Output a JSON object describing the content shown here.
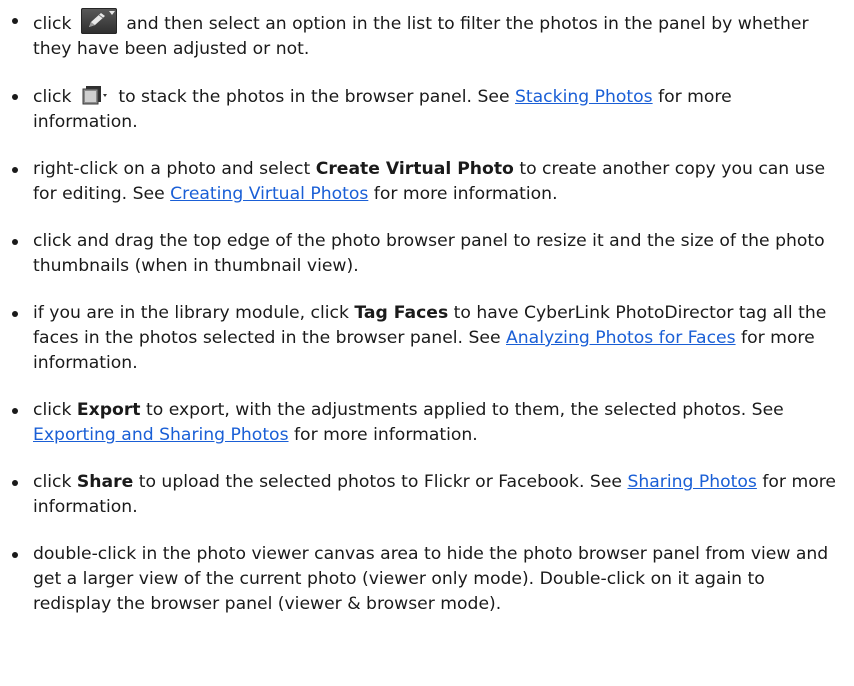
{
  "items": [
    {
      "a": "click",
      "icon": "edit-pencil-dropdown-icon",
      "b": "and then select an option in the list to filter the photos in the panel by whether they have been adjusted or not."
    },
    {
      "a": "click",
      "icon": "stack-dropdown-icon",
      "b": "to stack the photos in the browser panel. See",
      "link": "Stacking Photos",
      "c": "for more information."
    },
    {
      "a": "right-click on a photo and select",
      "bold": "Create Virtual Photo",
      "b": "to create another copy you can use for editing. See",
      "link": "Creating Virtual Photos",
      "c": "for more information."
    },
    {
      "a": "click and drag the top edge of the photo browser panel to resize it and the size of the photo thumbnails (when in thumbnail view)."
    },
    {
      "a": "if you are in the library module, click",
      "bold": "Tag Faces",
      "b": "to have CyberLink PhotoDirector tag all the faces in the photos selected in the browser panel. See",
      "link": "Analyzing Photos for Faces",
      "c": "for more information."
    },
    {
      "a": "click",
      "bold": "Export",
      "b": "to export, with the adjustments applied to them, the selected photos. See",
      "link": "Exporting and Sharing Photos",
      "c": "for more information."
    },
    {
      "a": "click",
      "bold": "Share",
      "b": "to upload the selected photos to Flickr or Facebook. See",
      "link": "Sharing Photos",
      "c": "for more information."
    },
    {
      "a": "double-click in the photo viewer canvas area to hide the photo browser panel from view and get a larger view of the current photo (viewer only mode). Double-click on it again to redisplay the browser panel (viewer & browser mode)."
    }
  ]
}
